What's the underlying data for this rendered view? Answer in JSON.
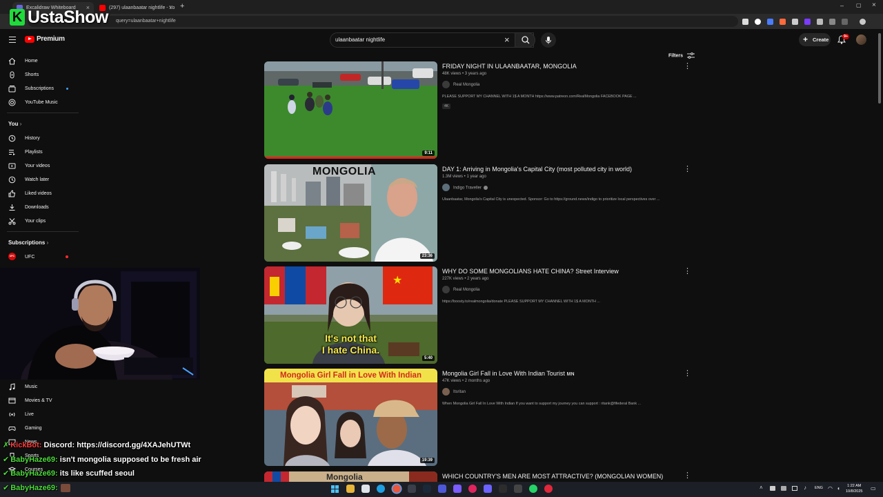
{
  "browser": {
    "tabs": [
      {
        "title": "Excalidraw Whiteboard"
      },
      {
        "title": "(297) ulaanbaatar nightlife - Yo"
      }
    ],
    "url": "query=ulaanbaatar+nightlife"
  },
  "overlay": {
    "logo_letter": "K",
    "logo_text": "UstaShow"
  },
  "youtube": {
    "logo_text": "Premium",
    "search_value": "ulaanbaatar nightlife",
    "create_label": "Create",
    "notification_count": "9+",
    "filters_label": "Filters"
  },
  "sidebar": {
    "main": [
      "Home",
      "Shorts",
      "Subscriptions",
      "YouTube Music"
    ],
    "you_heading": "You",
    "you_items": [
      "History",
      "Playlists",
      "Your videos",
      "Watch later",
      "Liked videos",
      "Downloads",
      "Your clips"
    ],
    "subscriptions_heading": "Subscriptions",
    "subscriptions": [
      "UFC"
    ],
    "explore": [
      "Music",
      "Movies & TV",
      "Live",
      "Gaming",
      "News",
      "Sports",
      "Courses"
    ]
  },
  "results": [
    {
      "title": "FRIDAY NIGHT IN ULAANBAATAR, MONGOLIA",
      "meta": "48K views • 3 years ago",
      "channel": "Real Mongolia",
      "description": "PLEASE SUPPORT MY CHANNEL WITH 1$ A MONTH https://www.patreon.com/RealMongolia FACEBOOK PAGE ...",
      "badge": "4K",
      "duration": "9:11"
    },
    {
      "title": "DAY 1: Arriving in Mongolia's Capital City (most polluted city in world)",
      "meta": "1.3M views • 1 year ago",
      "channel": "Indigo Traveller",
      "description": "Ulaanbaatar, Mongolia's Capital City is unexpected. Sponsor: Go to https://ground.news/indigo to prioritize local perspectives over ...",
      "duration": "23:36",
      "thumb_text": "MONGOLIA"
    },
    {
      "title": "WHY DO SOME MONGOLIANS HATE CHINA? Street Interview",
      "meta": "227K views • 2 years ago",
      "channel": "Real Mongolia",
      "description": "https://boosty.to/realmongolia/donate PLEASE SUPPORT MY CHANNEL WITH 1$ A MONTH ...",
      "duration": "5:40",
      "thumb_caption_1": "It's not that",
      "thumb_caption_2": "I hate China."
    },
    {
      "title": "Mongolia Girl Fall in Love With Indian Tourist ᴍɴ",
      "meta": "47K views • 2 months ago",
      "channel": "Itsritan",
      "description": "When Mongolia Girl Fall In Love With Indian If you want to support my journey you can support : ritank@fifederal Bank ...",
      "duration": "19:39",
      "thumb_banner": "Mongolia Girl Fall in Love With Indian"
    },
    {
      "title": "WHICH COUNTRY'S MEN ARE MOST ATTRACTIVE? (MONGOLIAN WOMEN)",
      "thumb_text": "Mongolia"
    }
  ],
  "chat": [
    {
      "user": "KickBot:",
      "message": "Discord: https://discord.gg/4XAJehUTWt"
    },
    {
      "user": "BabyHaze69:",
      "message": "isn't mongolia supposed to be fresh air"
    },
    {
      "user": "BabyHaze69:",
      "message": "its like scuffed seoul"
    },
    {
      "user": "BabyHaze69:",
      "message": ""
    }
  ],
  "taskbar": {
    "language": "ENG",
    "time": "1:22 AM",
    "date": "10/8/2025"
  }
}
